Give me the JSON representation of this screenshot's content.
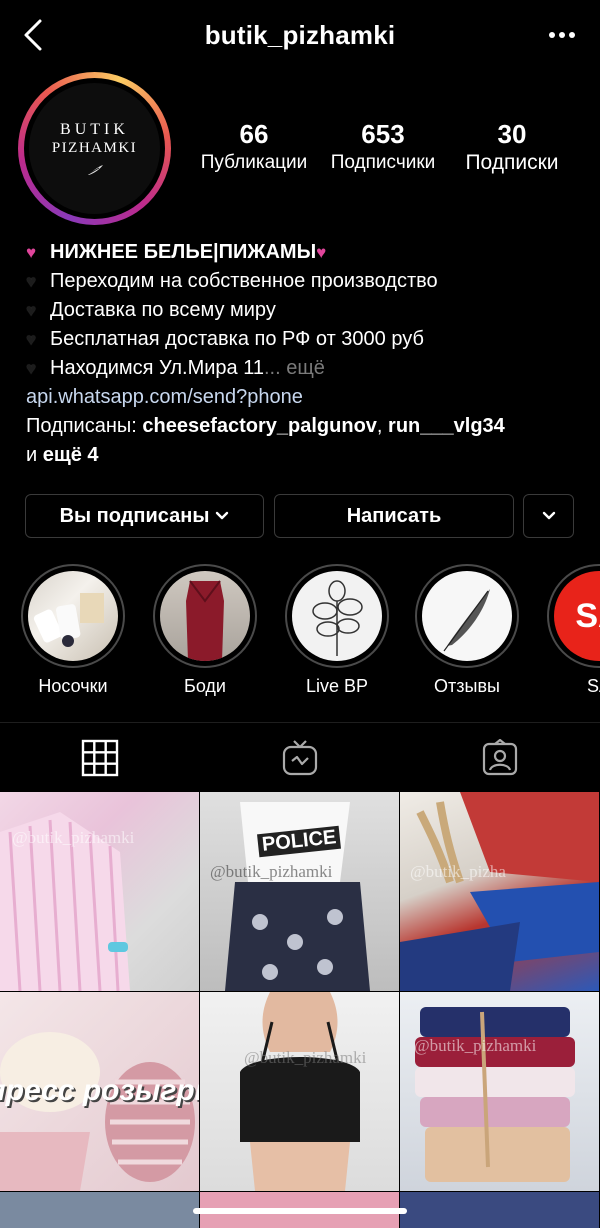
{
  "header": {
    "username": "butik_pizhamki",
    "back_icon": "chevron-left-icon",
    "more_icon": "more-horizontal-icon"
  },
  "avatar": {
    "logo_line1": "BUTIK",
    "logo_line2": "PIZHAMKI"
  },
  "stats": [
    {
      "count": "66",
      "label": "Публикации"
    },
    {
      "count": "653",
      "label": "Подписчики"
    },
    {
      "count": "30",
      "label": "Подписки"
    }
  ],
  "bio": {
    "name": "НИЖНЕЕ БЕЛЬЕ|ПИЖАМЫ",
    "lines": [
      "Переходим на собственное производство",
      "Доставка по всему миру",
      "Бесплатная доставка по РФ от 3000 руб",
      "Находимся Ул.Мира 11"
    ],
    "more_label": "... ещё",
    "link": "api.whatsapp.com/send?phone",
    "followed_by_prefix": "Подписаны: ",
    "followed_by_users": [
      "cheesefactory_palgunov",
      "run___vlg34"
    ],
    "followed_by_separator": ", ",
    "followed_by_and": "и ",
    "followed_by_more": "ещё 4"
  },
  "buttons": {
    "following": "Вы подписаны",
    "message": "Написать"
  },
  "highlights": [
    {
      "label": "Носочки"
    },
    {
      "label": "Боди"
    },
    {
      "label": "Live BP"
    },
    {
      "label": "Отзывы"
    },
    {
      "label": "SA",
      "badge": "SA"
    }
  ],
  "tabs": [
    "grid-icon",
    "igtv-icon",
    "tagged-icon"
  ],
  "posts": [
    {
      "watermark": "@butik_pizhamki"
    },
    {
      "watermark": "@butik_pizhamki",
      "print": "POLICE"
    },
    {
      "watermark": "@butik_pizha"
    },
    {
      "overlay": "пресс розыгрь"
    },
    {
      "watermark": "@butik_pizhamki"
    },
    {
      "watermark": "@butik_pizhamki"
    }
  ],
  "colors": {
    "background": "#000000",
    "link": "#c7d7ee",
    "muted": "#7a7a7a",
    "pink_heart": "#e0459b"
  }
}
